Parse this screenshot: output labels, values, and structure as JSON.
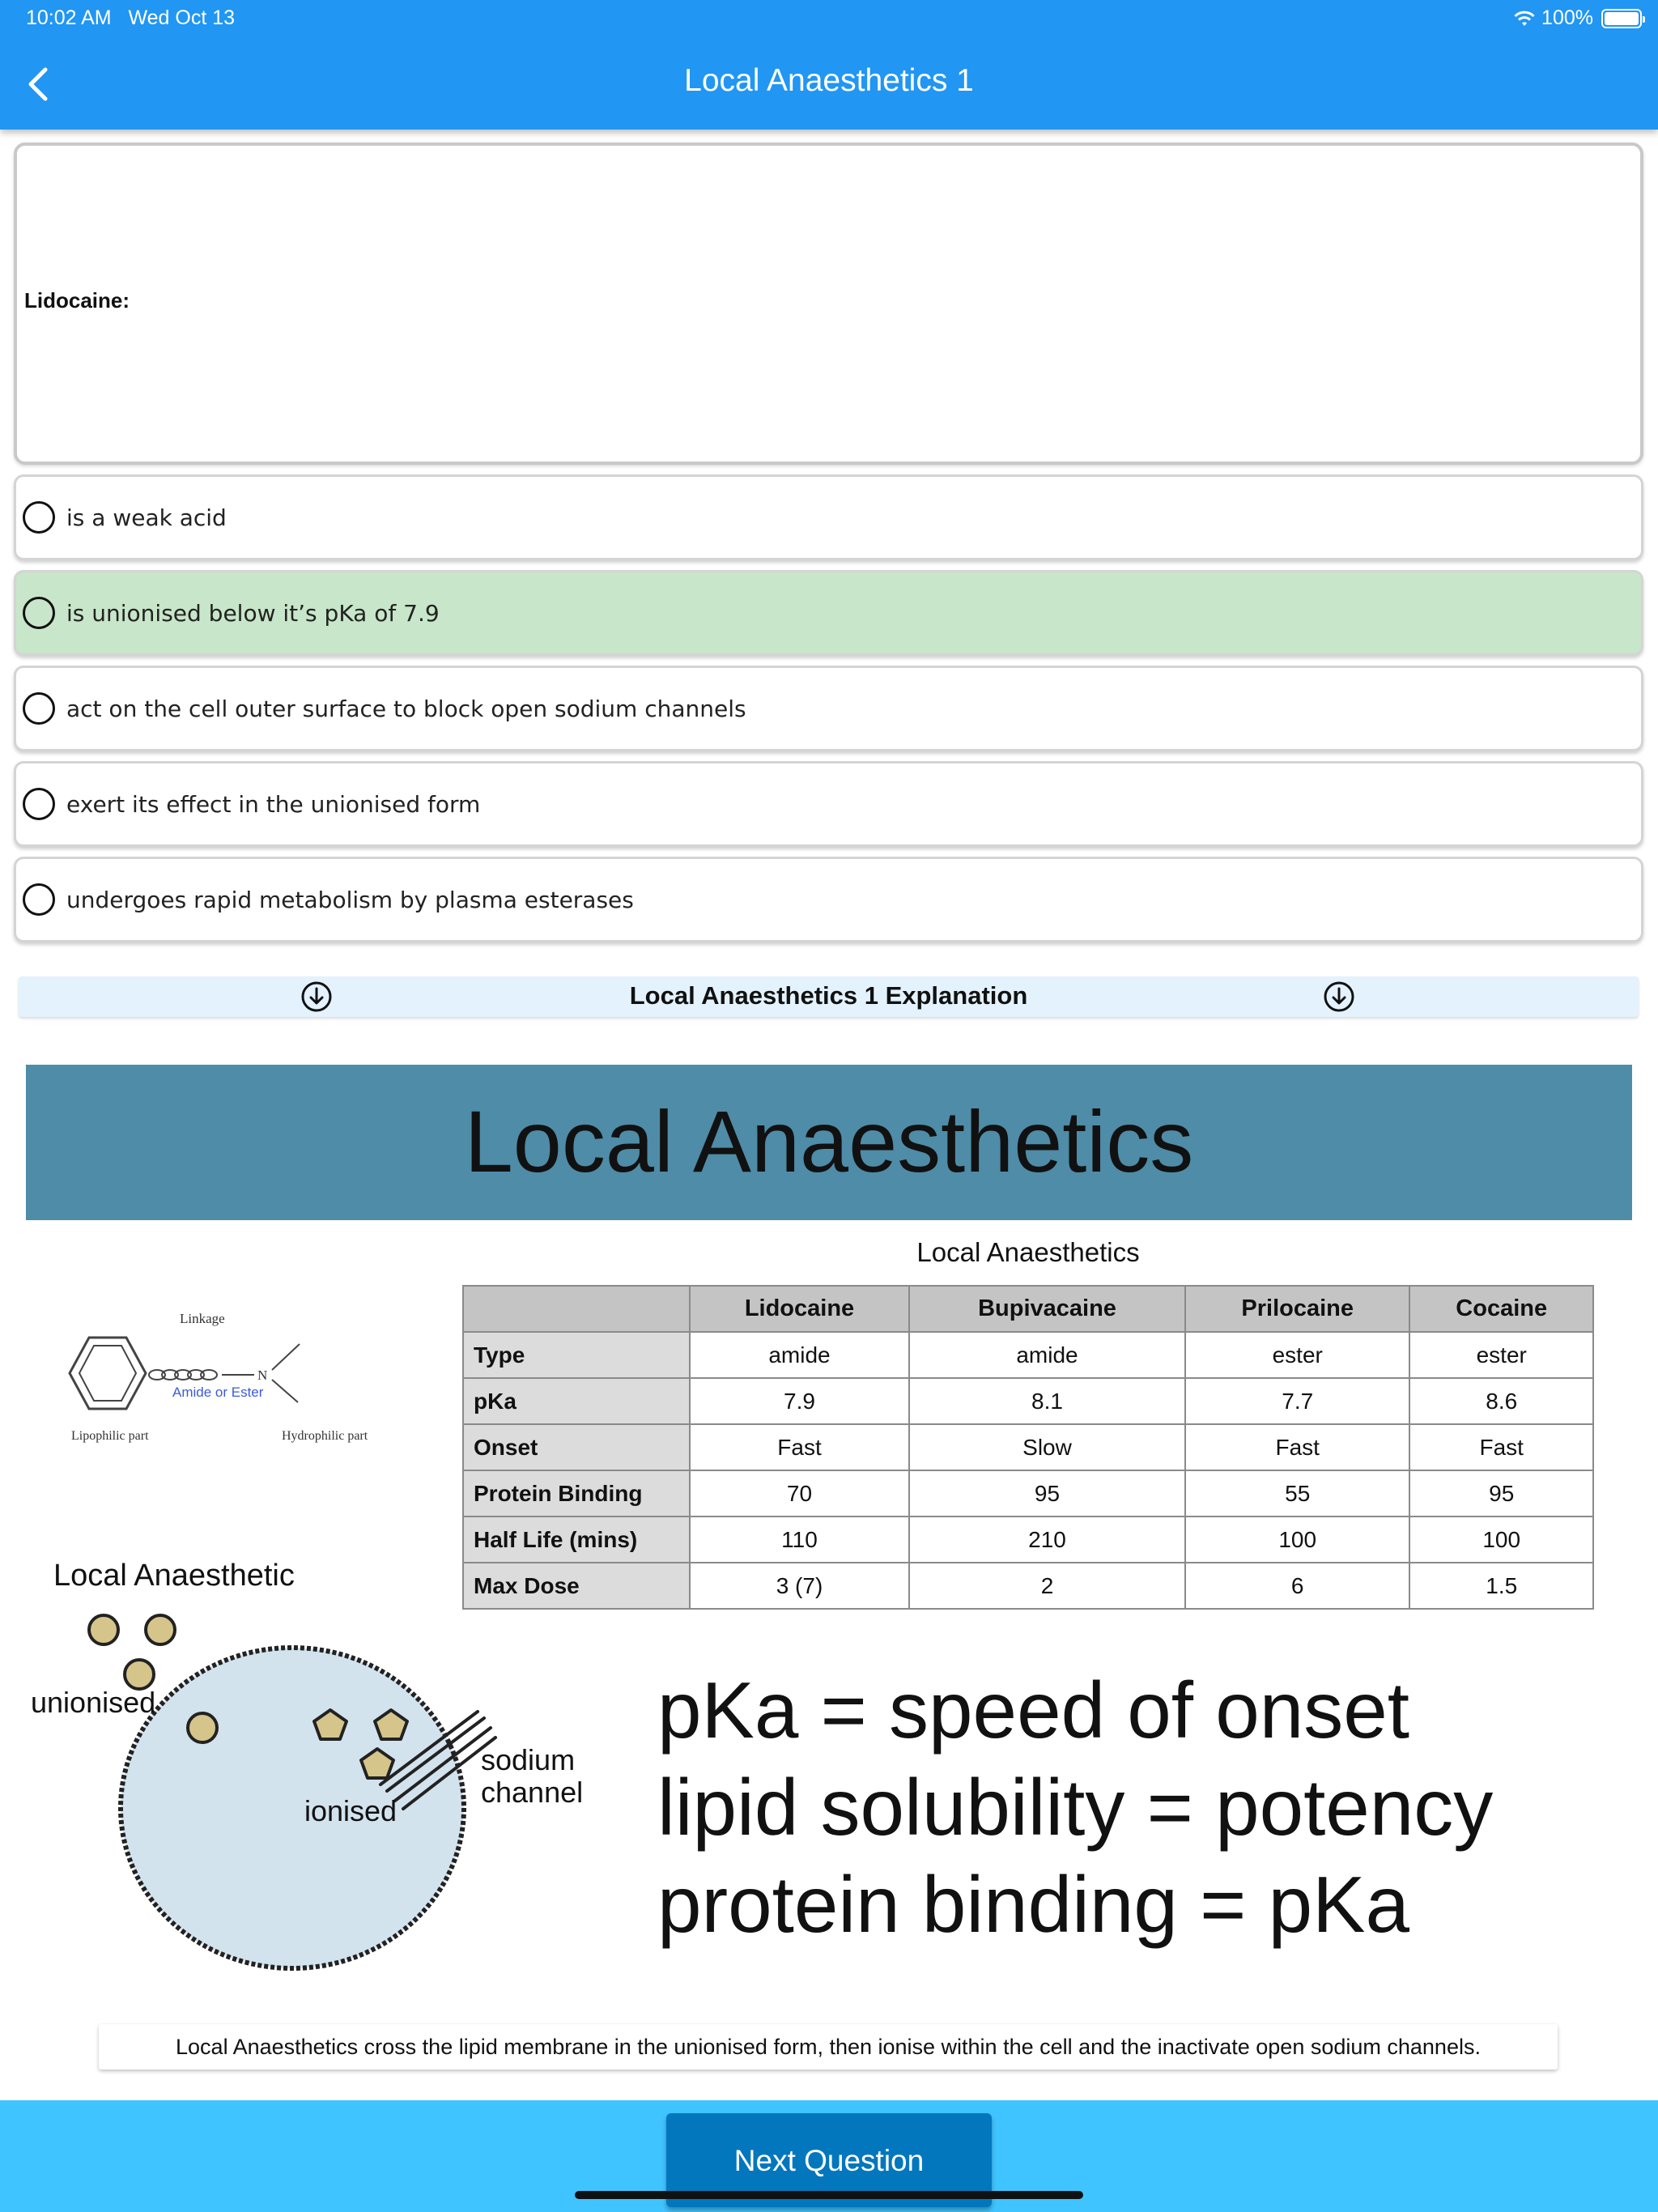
{
  "status_bar": {
    "time": "10:02 AM",
    "date": "Wed Oct 13",
    "battery": "100%",
    "icons": [
      "wifi-icon",
      "battery-icon"
    ]
  },
  "nav": {
    "title": "Local Anaesthetics 1",
    "back_icon": "chevron-left-icon"
  },
  "question": {
    "text": "Lidocaine:"
  },
  "answers": [
    {
      "label": "is a weak acid",
      "selected": false,
      "highlighted": false
    },
    {
      "label": "is unionised below it’s pKa of 7.9",
      "selected": false,
      "highlighted": true
    },
    {
      "label": "act on the cell outer surface to block open sodium channels",
      "selected": false,
      "highlighted": false
    },
    {
      "label": "exert its effect in the unionised form",
      "selected": false,
      "highlighted": false
    },
    {
      "label": "undergoes rapid metabolism by plasma esterases",
      "selected": false,
      "highlighted": false
    }
  ],
  "explanation": {
    "title": "Local Anaesthetics 1 Explanation",
    "icon": "download-circle-icon"
  },
  "slide": {
    "banner_title": "Local Anaesthetics",
    "table_caption": "Local Anaesthetics",
    "table": {
      "columns": [
        "",
        "Lidocaine",
        "Bupivacaine",
        "Prilocaine",
        "Cocaine"
      ],
      "rows": [
        [
          "Type",
          "amide",
          "amide",
          "ester",
          "ester"
        ],
        [
          "pKa",
          "7.9",
          "8.1",
          "7.7",
          "8.6"
        ],
        [
          "Onset",
          "Fast",
          "Slow",
          "Fast",
          "Fast"
        ],
        [
          "Protein Binding",
          "70",
          "95",
          "55",
          "95"
        ],
        [
          "Half Life (mins)",
          "110",
          "210",
          "100",
          "100"
        ],
        [
          "Max Dose",
          "3 (7)",
          "2",
          "6",
          "1.5"
        ]
      ]
    },
    "structure": {
      "linkage": "Linkage",
      "amide_or_ester": "Amide or Ester",
      "lipophilic": "Lipophilic part",
      "hydrophilic": "Hydrophilic part",
      "nitrogen": "N"
    },
    "diagram": {
      "title": "Local Anaesthetic",
      "unionised": "unionised",
      "ionised": "ionised",
      "sodium_channel": [
        "sodium",
        "channel"
      ],
      "cell_color": "#D3E3EE",
      "molecule_color": "#D6C58A"
    },
    "formulas": [
      "pKa = speed of onset",
      "lipid solubility = potency",
      "protein binding = pKa"
    ]
  },
  "caption": "Local Anaesthetics cross the lipid membrane in the unionised form, then ionise within the cell and the inactivate open sodium channels.",
  "footer": {
    "next_label": "Next Question"
  },
  "colors": {
    "appbar": "#2196F3",
    "correct_answer": "#C8E6C9",
    "footer": "#40C4FF",
    "next_button": "#0277BD",
    "slide_banner": "#4E8CA8"
  }
}
